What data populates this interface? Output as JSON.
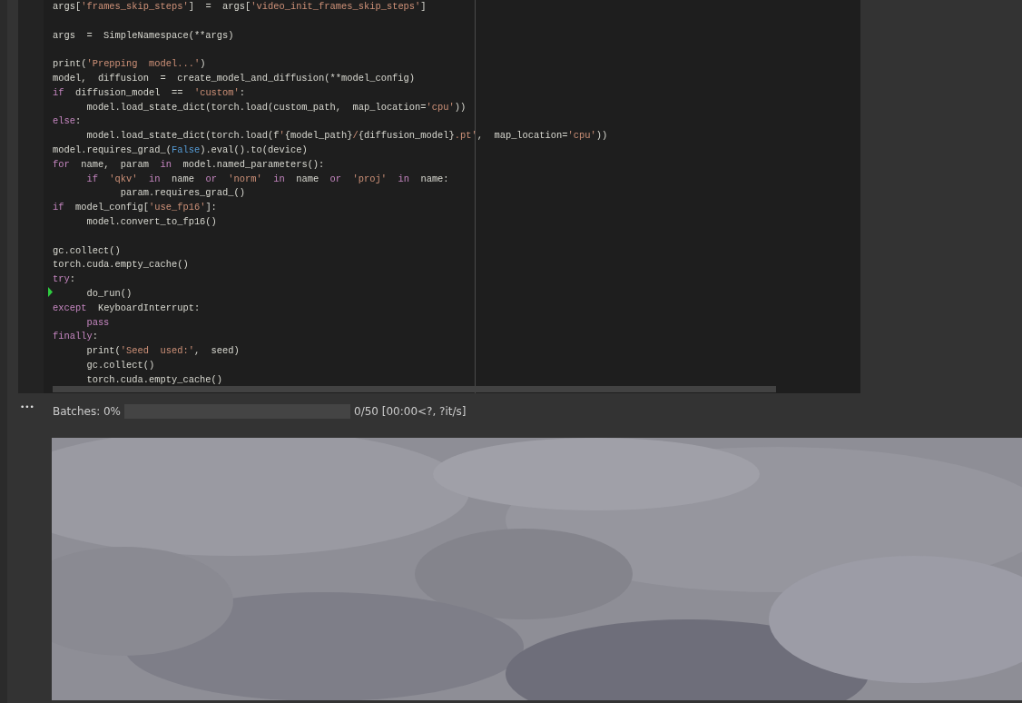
{
  "code_cell": {
    "blocks": [
      {
        "lines": [
          {
            "marker": false,
            "tokens": [
              {
                "text": "args[",
                "kind": "plain"
              },
              {
                "text": "'frames_skip_steps'",
                "kind": "string"
              },
              {
                "text": "]  =  args[",
                "kind": "plain"
              },
              {
                "text": "'video_init_frames_skip_steps'",
                "kind": "string"
              },
              {
                "text": "]",
                "kind": "plain"
              }
            ]
          }
        ]
      },
      {
        "lines": [
          {
            "marker": false,
            "tokens": [
              {
                "text": "args  =  SimpleNamespace(**args)",
                "kind": "plain"
              }
            ]
          }
        ]
      },
      {
        "lines": [
          {
            "marker": false,
            "tokens": [
              {
                "text": "print(",
                "kind": "plain"
              },
              {
                "text": "'Prepping  model...'",
                "kind": "string"
              },
              {
                "text": ")",
                "kind": "plain"
              }
            ]
          },
          {
            "marker": false,
            "tokens": [
              {
                "text": "model,  diffusion  =  create_model_and_diffusion(**model_config)",
                "kind": "plain"
              }
            ]
          },
          {
            "marker": false,
            "tokens": [
              {
                "text": "if",
                "kind": "keyword"
              },
              {
                "text": "  diffusion_model  ==  ",
                "kind": "plain"
              },
              {
                "text": "'custom'",
                "kind": "string"
              },
              {
                "text": ":",
                "kind": "plain"
              }
            ]
          },
          {
            "marker": false,
            "tokens": [
              {
                "text": "      model.load_state_dict(torch.load(custom_path,  map_location=",
                "kind": "plain"
              },
              {
                "text": "'cpu'",
                "kind": "string"
              },
              {
                "text": "))",
                "kind": "plain"
              }
            ]
          },
          {
            "marker": false,
            "tokens": [
              {
                "text": "else",
                "kind": "keyword"
              },
              {
                "text": ":",
                "kind": "plain"
              }
            ]
          },
          {
            "marker": false,
            "tokens": [
              {
                "text": "      model.load_state_dict(torch.load(f",
                "kind": "plain"
              },
              {
                "text": "'",
                "kind": "string"
              },
              {
                "text": "{model_path}",
                "kind": "plain"
              },
              {
                "text": "/",
                "kind": "string"
              },
              {
                "text": "{diffusion_model}",
                "kind": "plain"
              },
              {
                "text": ".pt'",
                "kind": "string"
              },
              {
                "text": ",  map_location=",
                "kind": "plain"
              },
              {
                "text": "'cpu'",
                "kind": "string"
              },
              {
                "text": "))",
                "kind": "plain"
              }
            ]
          },
          {
            "marker": false,
            "tokens": [
              {
                "text": "model.requires_grad_(",
                "kind": "plain"
              },
              {
                "text": "False",
                "kind": "constant"
              },
              {
                "text": ").eval().to(device)",
                "kind": "plain"
              }
            ]
          },
          {
            "marker": false,
            "tokens": [
              {
                "text": "for",
                "kind": "keyword"
              },
              {
                "text": "  name,  param  ",
                "kind": "plain"
              },
              {
                "text": "in",
                "kind": "keyword"
              },
              {
                "text": "  model.named_parameters():",
                "kind": "plain"
              }
            ]
          },
          {
            "marker": false,
            "tokens": [
              {
                "text": "      if",
                "kind": "keyword"
              },
              {
                "text": "  'qkv'",
                "kind": "string"
              },
              {
                "text": "  in",
                "kind": "keyword"
              },
              {
                "text": "  name  ",
                "kind": "plain"
              },
              {
                "text": "or",
                "kind": "keyword"
              },
              {
                "text": "  'norm'",
                "kind": "string"
              },
              {
                "text": "  in",
                "kind": "keyword"
              },
              {
                "text": "  name  ",
                "kind": "plain"
              },
              {
                "text": "or",
                "kind": "keyword"
              },
              {
                "text": "  'proj'",
                "kind": "string"
              },
              {
                "text": "  in",
                "kind": "keyword"
              },
              {
                "text": "  name:",
                "kind": "plain"
              }
            ]
          },
          {
            "marker": false,
            "tokens": [
              {
                "text": "            param.requires_grad_()",
                "kind": "plain"
              }
            ]
          },
          {
            "marker": false,
            "tokens": [
              {
                "text": "if",
                "kind": "keyword"
              },
              {
                "text": "  model_config[",
                "kind": "plain"
              },
              {
                "text": "'use_fp16'",
                "kind": "string"
              },
              {
                "text": "]:",
                "kind": "plain"
              }
            ]
          },
          {
            "marker": false,
            "tokens": [
              {
                "text": "      model.convert_to_fp16()",
                "kind": "plain"
              }
            ]
          }
        ]
      },
      {
        "lines": [
          {
            "marker": false,
            "tokens": [
              {
                "text": "gc.collect()",
                "kind": "plain"
              }
            ]
          },
          {
            "marker": false,
            "tokens": [
              {
                "text": "torch.cuda.empty_cache()",
                "kind": "plain"
              }
            ]
          },
          {
            "marker": false,
            "tokens": [
              {
                "text": "try",
                "kind": "keyword"
              },
              {
                "text": ":",
                "kind": "plain"
              }
            ]
          },
          {
            "marker": true,
            "tokens": [
              {
                "text": "      do_run()",
                "kind": "plain"
              }
            ]
          },
          {
            "marker": false,
            "tokens": [
              {
                "text": "except",
                "kind": "keyword"
              },
              {
                "text": "  KeyboardInterrupt:",
                "kind": "plain"
              }
            ]
          },
          {
            "marker": false,
            "tokens": [
              {
                "text": "      pass",
                "kind": "keyword"
              }
            ]
          },
          {
            "marker": false,
            "tokens": [
              {
                "text": "finally",
                "kind": "keyword"
              },
              {
                "text": ":",
                "kind": "plain"
              }
            ]
          },
          {
            "marker": false,
            "tokens": [
              {
                "text": "      print(",
                "kind": "plain"
              },
              {
                "text": "'Seed  used:'",
                "kind": "string"
              },
              {
                "text": ",  seed)",
                "kind": "plain"
              }
            ]
          },
          {
            "marker": false,
            "tokens": [
              {
                "text": "      gc.collect()",
                "kind": "plain"
              }
            ]
          },
          {
            "marker": false,
            "tokens": [
              {
                "text": "      torch.cuda.empty_cache()",
                "kind": "plain"
              }
            ]
          }
        ]
      }
    ]
  },
  "output": {
    "more_glyph": "•••",
    "progress": {
      "label": "Batches: 0%",
      "level": 0,
      "reading": "0/50 [00:00<?, ?it/s]"
    }
  }
}
